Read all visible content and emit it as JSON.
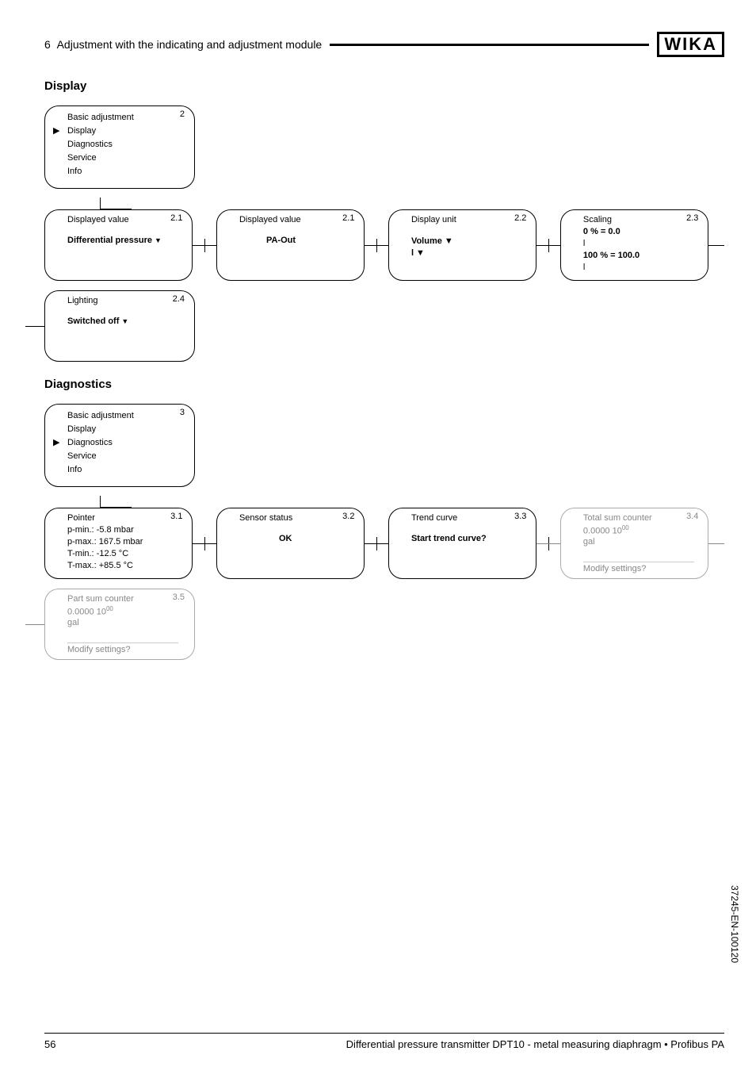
{
  "header": {
    "chapter_num": "6",
    "chapter_title": "Adjustment with the indicating and adjustment module",
    "logo": "WIKA"
  },
  "display_section": {
    "title": "Display",
    "menu": {
      "badge": "2",
      "items": [
        "Basic adjustment",
        "Display",
        "Diagnostics",
        "Service",
        "Info"
      ],
      "selected_index": 1
    },
    "row": [
      {
        "badge": "2.1",
        "title": "Displayed value",
        "body": "Differential pressure",
        "dropdown": true
      },
      {
        "badge": "2.1",
        "title": "Displayed value",
        "body": "PA-Out"
      },
      {
        "badge": "2.2",
        "title": "Display unit",
        "body_lines": [
          "Volume ▼",
          "l ▼"
        ]
      },
      {
        "badge": "2.3",
        "title": "Scaling",
        "lines": [
          "0 % = 0.0",
          "l",
          "100 % = 100.0",
          "l"
        ]
      }
    ],
    "row2": [
      {
        "badge": "2.4",
        "title": "Lighting",
        "body": "Switched off",
        "dropdown": true
      }
    ]
  },
  "diagnostics_section": {
    "title": "Diagnostics",
    "menu": {
      "badge": "3",
      "items": [
        "Basic adjustment",
        "Display",
        "Diagnostics",
        "Service",
        "Info"
      ],
      "selected_index": 2
    },
    "row": [
      {
        "badge": "3.1",
        "title": "Pointer",
        "lines": [
          "p-min.: -5.8 mbar",
          "p-max.: 167.5 mbar",
          "T-min.: -12.5 °C",
          "T-max.: +85.5 °C"
        ]
      },
      {
        "badge": "3.2",
        "title": "Sensor status",
        "body": "OK"
      },
      {
        "badge": "3.3",
        "title": "Trend curve",
        "body": "Start trend curve?"
      },
      {
        "badge": "3.4",
        "title": "Total sum counter",
        "value": "0.0000 10",
        "exp": "00",
        "unit": "gal",
        "footer": "Modify settings?",
        "greyed": true
      }
    ],
    "row2": [
      {
        "badge": "3.5",
        "title": "Part sum counter",
        "value": "0.0000 10",
        "exp": "00",
        "unit": "gal",
        "footer": "Modify settings?",
        "greyed": true
      }
    ]
  },
  "footer": {
    "page": "56",
    "text": "Differential pressure transmitter DPT10 - metal measuring diaphragm • Profibus PA"
  },
  "docnum": "37245-EN-100120"
}
